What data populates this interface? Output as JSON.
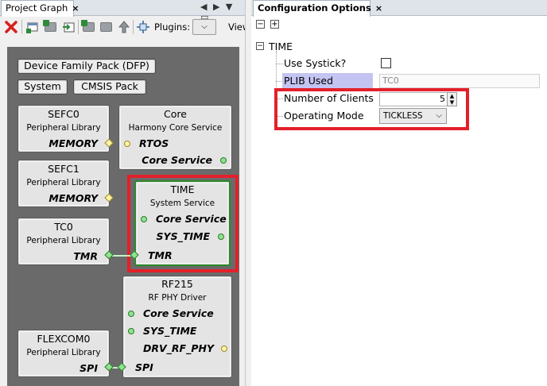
{
  "left_panel": {
    "tab_label": "Project Graph",
    "tab_close": "×",
    "tab_controls": "◀ ▶ ▼ ▭",
    "toolbar": {
      "plugins_label": "Plugins:",
      "plugins_value": "",
      "view_label": "View:"
    },
    "graph": {
      "dfp_label": "Device Family Pack (DFP)",
      "system_label": "System",
      "cmsis_label": "CMSIS Pack",
      "nodes": {
        "sefc0": {
          "title": "SEFC0",
          "subtitle": "Peripheral Library",
          "port": "MEMORY"
        },
        "core": {
          "title": "Core",
          "subtitle": "Harmony Core Service",
          "port_in": "RTOS",
          "port_out": "Core Service"
        },
        "sefc1": {
          "title": "SEFC1",
          "subtitle": "Peripheral Library",
          "port": "MEMORY"
        },
        "time": {
          "title": "TIME",
          "subtitle": "System Service",
          "port_core": "Core Service",
          "port_systime": "SYS_TIME",
          "port_tmr": "TMR"
        },
        "tc0": {
          "title": "TC0",
          "subtitle": "Peripheral Library",
          "port": "TMR"
        },
        "rf215": {
          "title": "RF215",
          "subtitle": "RF PHY Driver",
          "port_core": "Core Service",
          "port_systime": "SYS_TIME",
          "port_drv": "DRV_RF_PHY",
          "port_spi": "SPI"
        },
        "flexcom0": {
          "title": "FLEXCOM0",
          "subtitle": "Peripheral Library",
          "port": "SPI"
        }
      }
    }
  },
  "right_panel": {
    "tab_label": "Configuration Options",
    "tab_close": "×",
    "collapse_all": "−",
    "expand_all": "+",
    "tree": {
      "root_label": "TIME",
      "root_toggle": "−",
      "use_systick_label": "Use Systick?",
      "use_systick_checked": false,
      "plib_used_label": "PLIB Used",
      "plib_used_value": "TC0",
      "num_clients_label": "Number of Clients",
      "num_clients_value": "5",
      "op_mode_label": "Operating Mode",
      "op_mode_value": "TICKLESS"
    }
  },
  "colors": {
    "highlight": "#e3202a",
    "graph_background": "#6a6a6a",
    "plib_highlight": "#c4c4f2",
    "port_green": "#8fe38f",
    "port_yellow": "#fff2a6"
  }
}
